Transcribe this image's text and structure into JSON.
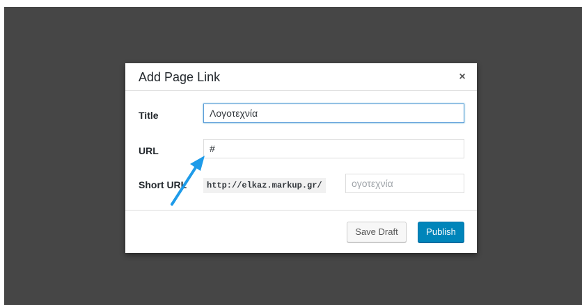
{
  "dialog": {
    "title": "Add Page Link",
    "close_icon": "close-icon",
    "close_glyph": "×"
  },
  "form": {
    "title_label": "Title",
    "title_value": "Λογοτεχνία",
    "url_label": "URL",
    "url_value": "#",
    "short_url_label": "Short URL",
    "short_url_prefix": "http://elkaz.markup.gr/",
    "slug_placeholder": "ογοτεχνία"
  },
  "footer": {
    "save_draft_label": "Save Draft",
    "publish_label": "Publish"
  },
  "annotation": {
    "arrow_icon": "arrow-icon",
    "arrow_color": "#1e9be9"
  },
  "colors": {
    "overlay": "#464646",
    "primary": "#0085ba",
    "focus": "#5b9dd9"
  }
}
